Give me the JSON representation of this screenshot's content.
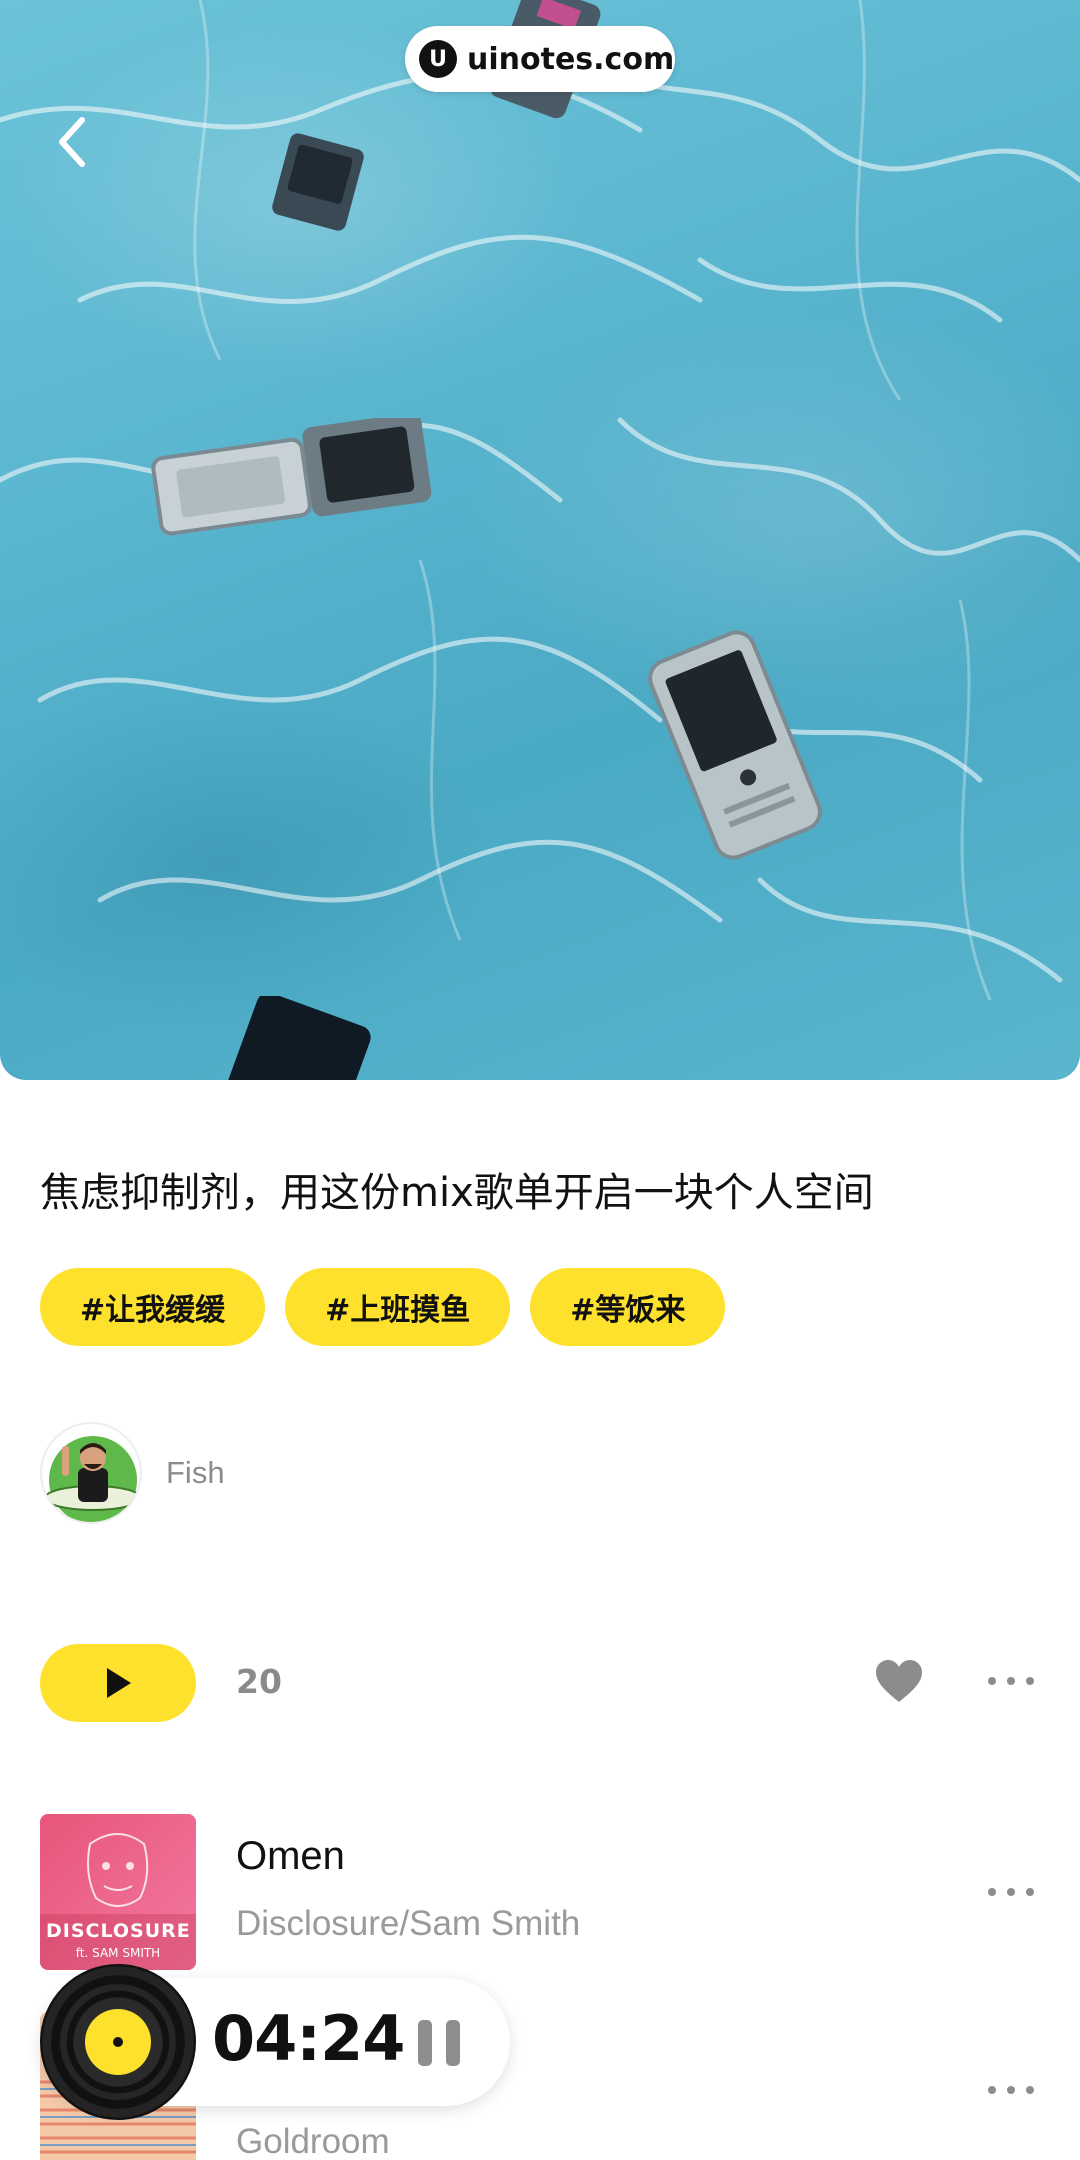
{
  "hero": {
    "alt": "phones-in-pool-photo"
  },
  "watermark": {
    "logo_letter": "U",
    "text": "uinotes.com"
  },
  "playlist": {
    "title": "焦虑抑制剂，用这份mix歌单开启一块个人空间",
    "tags": [
      "#让我缓缓",
      "#上班摸鱼",
      "#等饭来"
    ],
    "author": "Fish"
  },
  "actions": {
    "count": "20"
  },
  "tracks": [
    {
      "title": "Omen",
      "artist": "Disclosure/Sam Smith",
      "cover_text": "DISCLOSURE",
      "cover_sub": "ft. SAM SMITH"
    },
    {
      "title": "",
      "artist": "Goldroom"
    }
  ],
  "player": {
    "time": "04:24"
  },
  "colors": {
    "accent": "#fde12d",
    "pool": "#5bb6cf",
    "muted_text": "#9a9a9a"
  },
  "icons": [
    "back-arrow-icon",
    "play-icon",
    "heart-icon",
    "more-icon",
    "pause-icon",
    "vinyl-icon"
  ]
}
